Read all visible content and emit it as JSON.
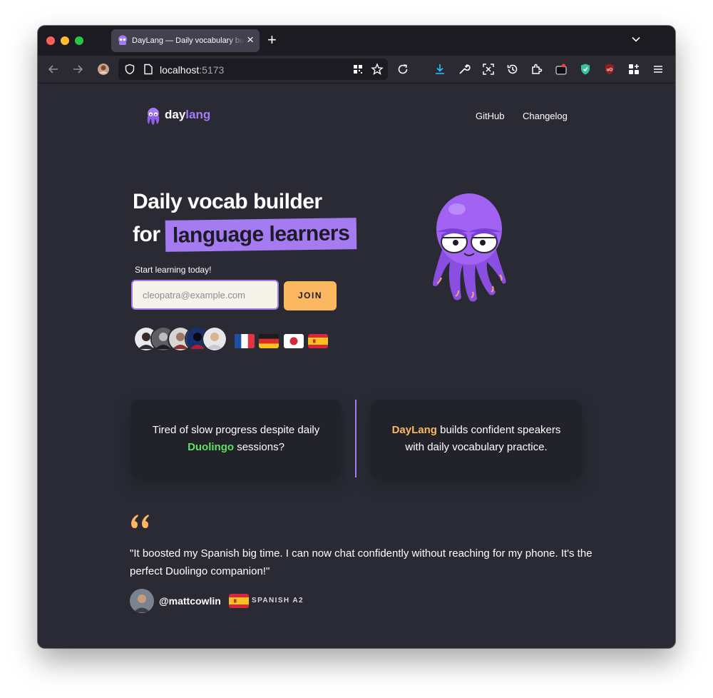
{
  "browser": {
    "tab_title": "DayLang — Daily vocabulary builder",
    "tab_close": "×",
    "new_tab": "+",
    "url_host": "localhost",
    "url_port": ":5173"
  },
  "nav": {
    "brand_day": "day",
    "brand_lang": "lang",
    "links": [
      "GitHub",
      "Changelog"
    ]
  },
  "hero": {
    "title_line1": "Daily vocab builder",
    "title_for": "for",
    "title_highlight": "language learners",
    "start_label": "Start learning today!",
    "email_placeholder": "cleopatra@example.com",
    "join_label": "JOIN",
    "flags": [
      "France",
      "Germany",
      "Japan",
      "Spain"
    ]
  },
  "cards": {
    "problem_text": "Tired of slow progress despite daily",
    "problem_brand": "Duolingo",
    "problem_suffix": "sessions?",
    "solution_brand": "DayLang",
    "solution_text": "builds confident speakers with daily vocabulary practice."
  },
  "testimonial": {
    "quote": "\"It boosted my Spanish big time. I can now chat confidently without reaching for my phone. It's the perfect Duolingo companion!\"",
    "handle": "@mattcowlin",
    "language_level": "SPANISH A2"
  },
  "colors": {
    "accent_purple": "#a57bf2",
    "accent_orange": "#fbb860",
    "duolingo_green": "#5ee061",
    "page_bg": "#2a2a35"
  }
}
